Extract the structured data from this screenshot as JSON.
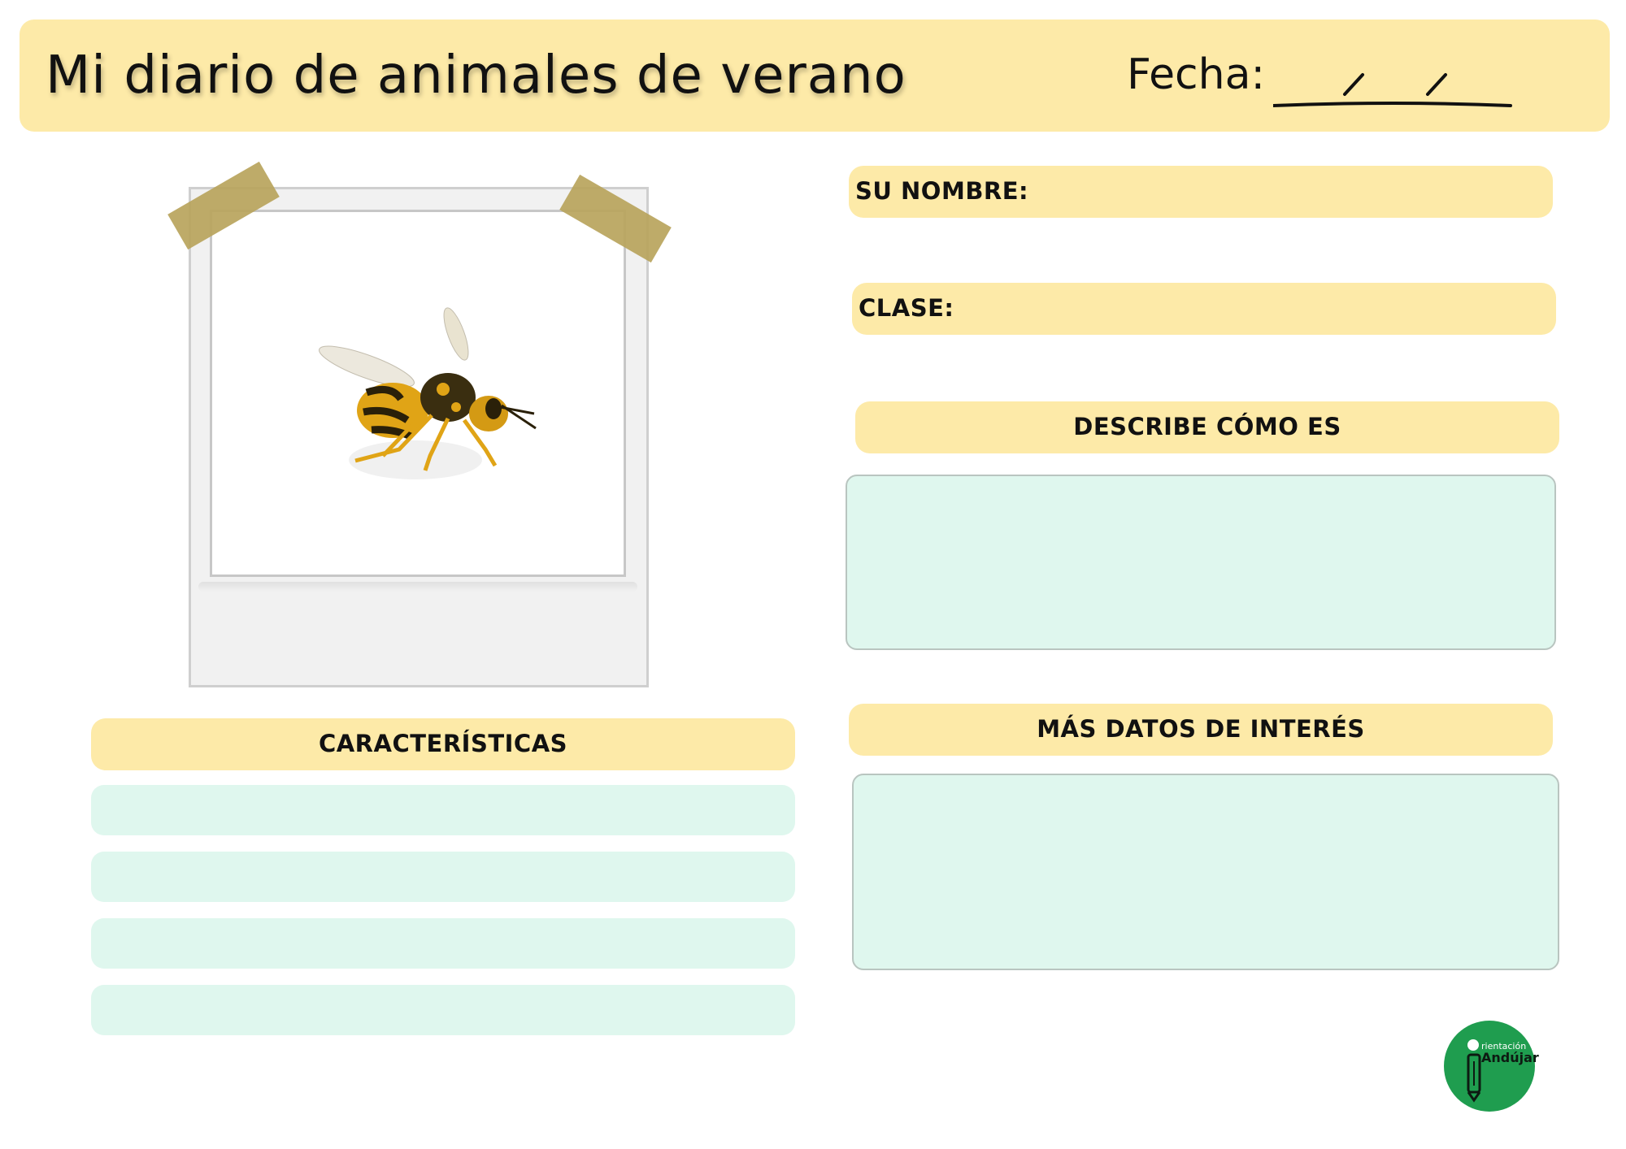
{
  "header": {
    "title": "Mi diario de animales de verano",
    "date_label": "Fecha:"
  },
  "fields": {
    "nombre_label": "SU NOMBRE:",
    "clase_label": "CLASE:"
  },
  "sections": {
    "describe": "DESCRIBE CÓMO ES",
    "datos": "MÁS DATOS DE INTERÉS",
    "caracteristicas": "CARACTERÍSTICAS"
  },
  "photo": {
    "subject": "wasp",
    "icon": "wasp-photo"
  },
  "logo": {
    "brand": "Orientación Andújar",
    "line1": "rientación",
    "line2": "Andújar"
  },
  "colors": {
    "header_band": "#fdeaa8",
    "label_band": "#fdeaa8",
    "writing_box": "#dff7ee",
    "logo_green": "#1f9d4f",
    "tape": "#b9a45c"
  }
}
